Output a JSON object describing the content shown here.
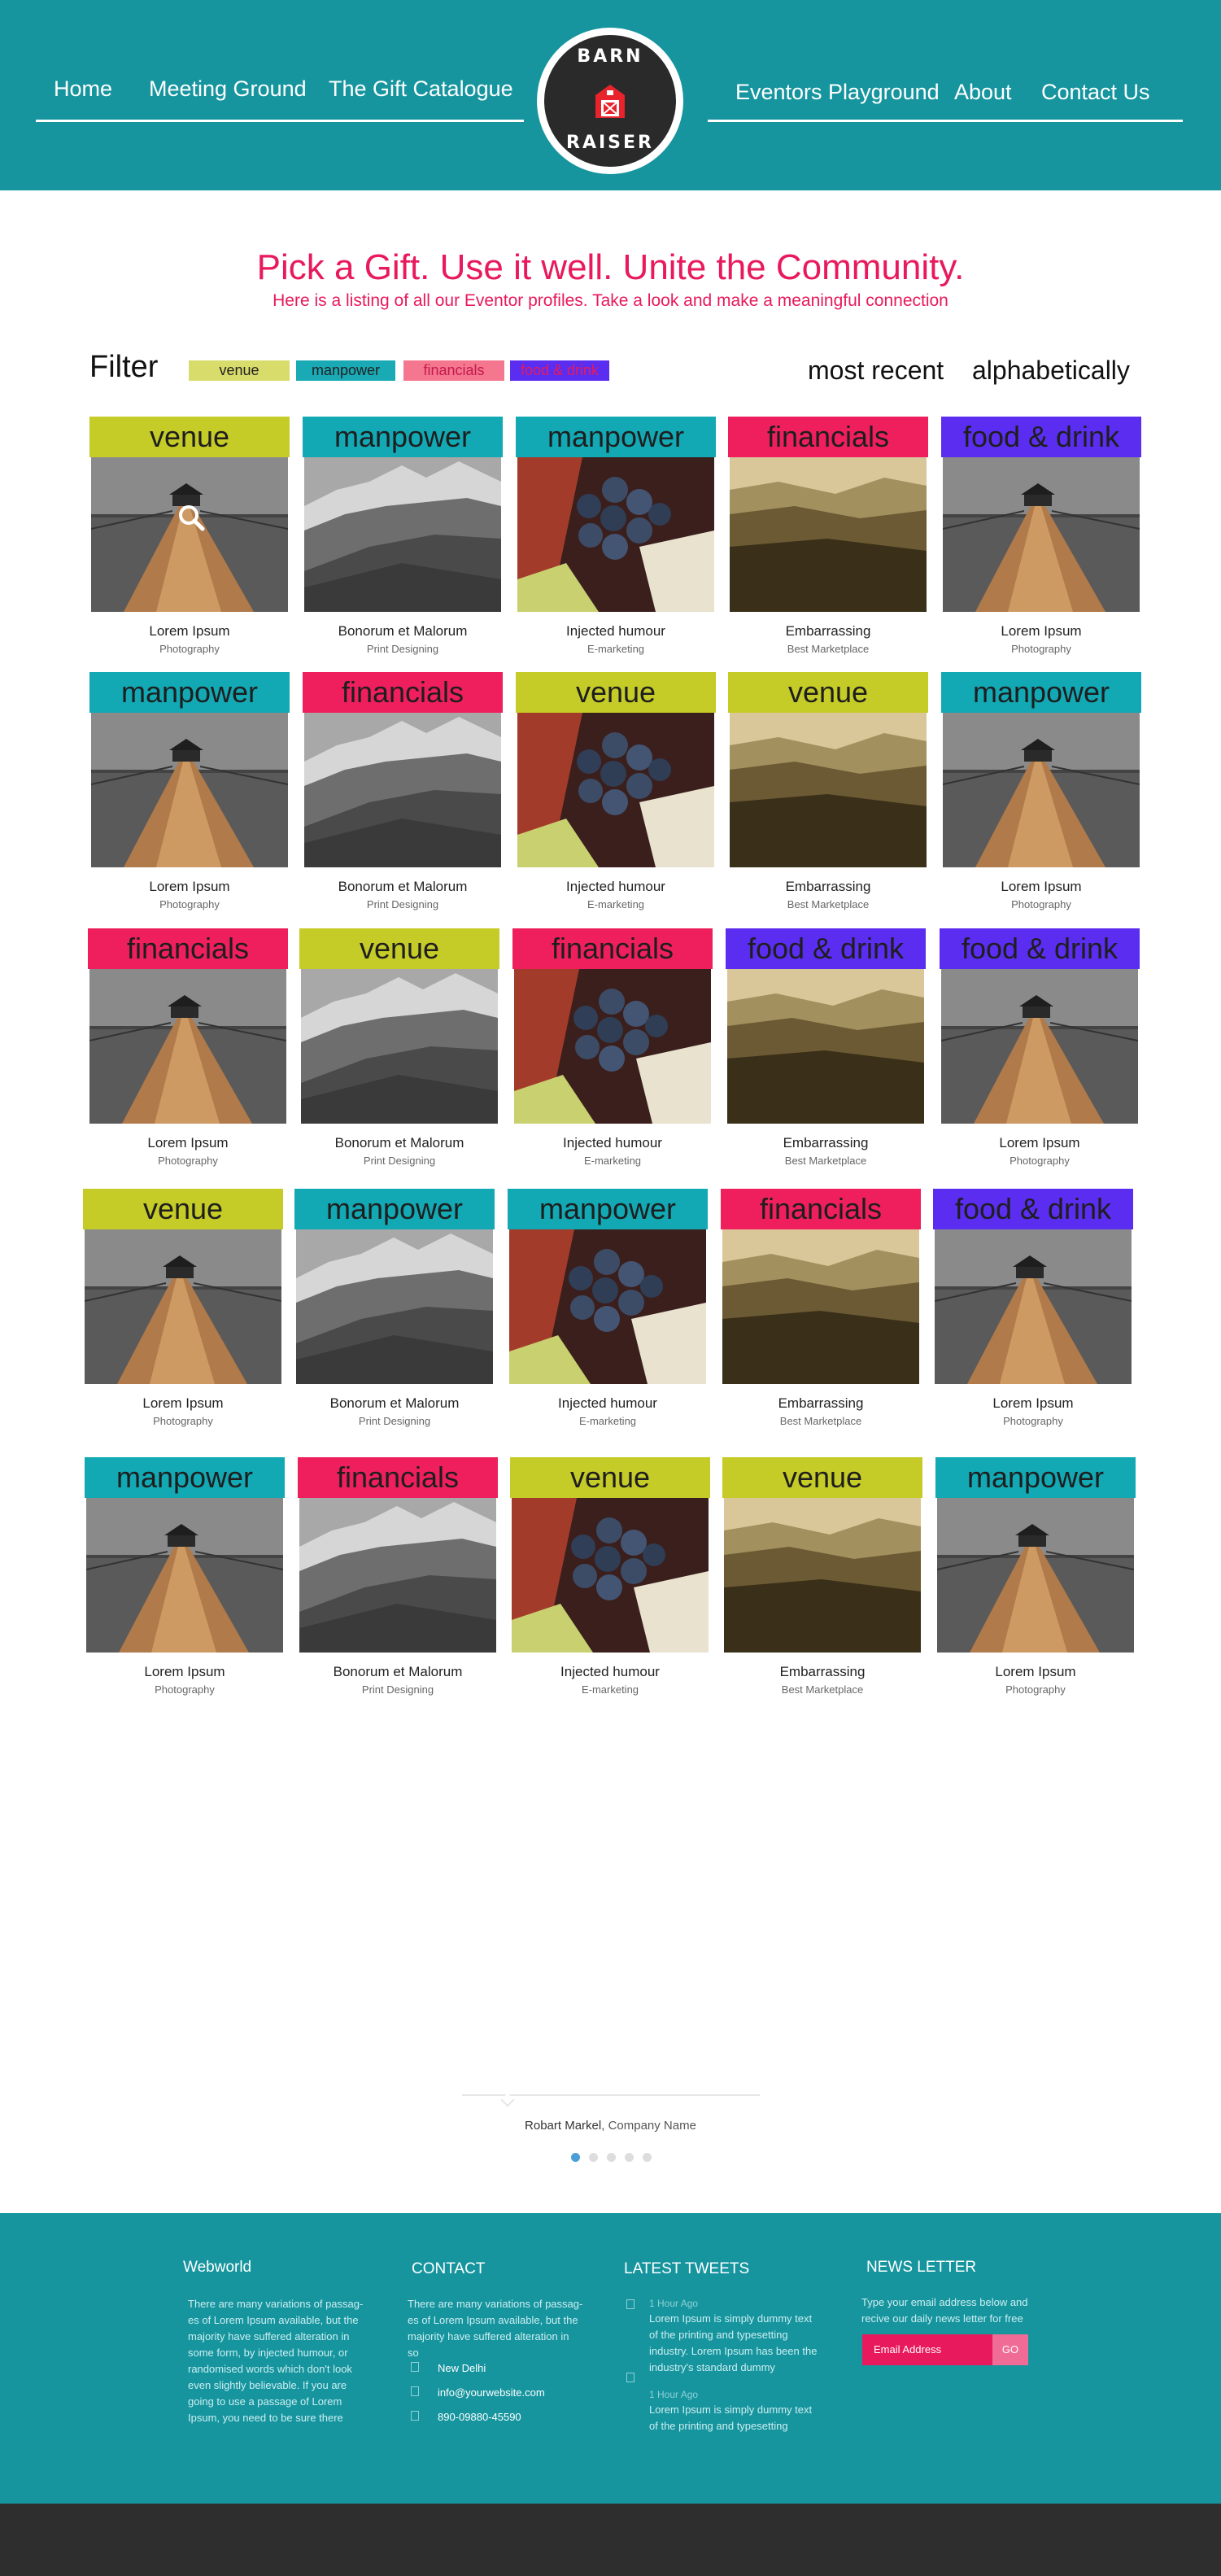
{
  "nav": {
    "left": [
      "Home",
      "Meeting Ground",
      "The Gift  Catalogue"
    ],
    "right": [
      "Eventors Playground",
      "About",
      "Contact Us"
    ]
  },
  "logo": {
    "line1": "BARN",
    "line2": "RAISER"
  },
  "intro": {
    "headline": "Pick a Gift. Use it well. Unite the Community.",
    "subline": "Here is a listing of all our  Eventor profiles. Take a look and make a meaningful connection"
  },
  "filter": {
    "label": "Filter",
    "chips": [
      "venue",
      "manpower",
      "financials",
      "food & drink"
    ],
    "sort": [
      "most recent",
      "alphabetically"
    ]
  },
  "colors": {
    "venue": "#c5cb27",
    "manpower": "#12a8b4",
    "financials": "#ef1f5e",
    "food": "#5a2df0",
    "chip_venue": "#d8dc6a",
    "chip_manpower": "#1aaab5",
    "chip_financials": "#f4768f",
    "chip_food": "#5a2df0",
    "teal": "#16959f",
    "pink": "#e8195c"
  },
  "columns": [
    {
      "title": "Lorem Ipsum",
      "subtitle": "Photography",
      "image": "pier"
    },
    {
      "title": "Bonorum et Malorum",
      "subtitle": "Print Designing",
      "image": "mountains"
    },
    {
      "title": "Injected humour",
      "subtitle": "E-marketing",
      "image": "grapes"
    },
    {
      "title": "Embarrassing",
      "subtitle": "Best Marketplace",
      "image": "valley"
    },
    {
      "title": "Lorem Ipsum",
      "subtitle": "Photography",
      "image": "pier"
    }
  ],
  "rows": [
    [
      "venue",
      "manpower",
      "manpower",
      "financials",
      "food & drink"
    ],
    [
      "manpower",
      "financials",
      "venue",
      "venue",
      "manpower"
    ],
    [
      "financials",
      "venue",
      "financials",
      "food & drink",
      "food & drink"
    ],
    [
      "venue",
      "manpower",
      "manpower",
      "financials",
      "food & drink"
    ],
    [
      "manpower",
      "financials",
      "venue",
      "venue",
      "manpower"
    ]
  ],
  "testimonial": {
    "name": "Robart Markel",
    "company": ", Company Name",
    "dots": 5,
    "active_dot": 0
  },
  "footer": {
    "col1": {
      "title": "Webworld",
      "text": [
        "There are many variations of passag-",
        "es of Lorem Ipsum available, but the",
        "majority have suffered alteration in",
        "some form, by injected humour, or",
        "randomised words which don't look",
        "even slightly believable. If you are",
        "going to use a passage of Lorem",
        "Ipsum, you need to be sure there"
      ]
    },
    "col2": {
      "title": "CONTACT",
      "text": [
        "There are many variations of passag-",
        "es of Lorem Ipsum available, but the",
        "majority have suffered alteration in",
        "so"
      ],
      "city": "New Delhi",
      "email": "info@yourwebsite.com",
      "phone": "890-09880-45590"
    },
    "col3": {
      "title": "LATEST TWEETS",
      "tweets": [
        {
          "time": "1 Hour Ago",
          "text": [
            "Lorem Ipsum is simply dummy text",
            "of the printing and typesetting",
            "industry. Lorem Ipsum has been the",
            "industry's standard dummy"
          ]
        },
        {
          "time": "1 Hour Ago",
          "text": [
            "Lorem Ipsum is simply dummy text",
            "of the printing and typesetting"
          ]
        }
      ]
    },
    "col4": {
      "title": "NEWS LETTER",
      "text": [
        "Type your email address below and",
        "recive our daily news letter for free"
      ],
      "placeholder": "Email Address",
      "button": "GO"
    }
  }
}
